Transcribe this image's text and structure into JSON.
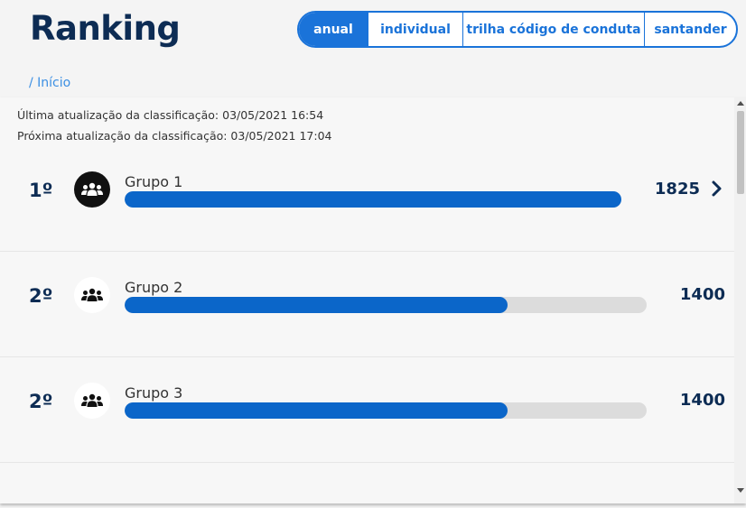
{
  "header": {
    "title": "Ranking"
  },
  "tabs": [
    {
      "label": "anual",
      "active": true
    },
    {
      "label": "individual",
      "active": false
    },
    {
      "label": "trilha código de conduta",
      "active": false
    },
    {
      "label": "santander",
      "active": false
    }
  ],
  "breadcrumb": {
    "label": "/ Início"
  },
  "updates": {
    "last": "Última atualização da classificação: 03/05/2021 16:54",
    "next": "Próxima atualização da classificação: 03/05/2021 17:04"
  },
  "ranking": [
    {
      "position": "1º",
      "name": "Grupo 1",
      "score": "1825",
      "progress": 1.0,
      "icon": "group-icon",
      "has_chevron": true
    },
    {
      "position": "2º",
      "name": "Grupo 2",
      "score": "1400",
      "progress": 0.77,
      "icon": "group-icon",
      "has_chevron": false
    },
    {
      "position": "2º",
      "name": "Grupo 3",
      "score": "1400",
      "progress": 0.77,
      "icon": "group-icon",
      "has_chevron": false
    }
  ],
  "colors": {
    "accent": "#1a73d9",
    "bar": "#0b66c9",
    "title": "#0d2c54"
  }
}
